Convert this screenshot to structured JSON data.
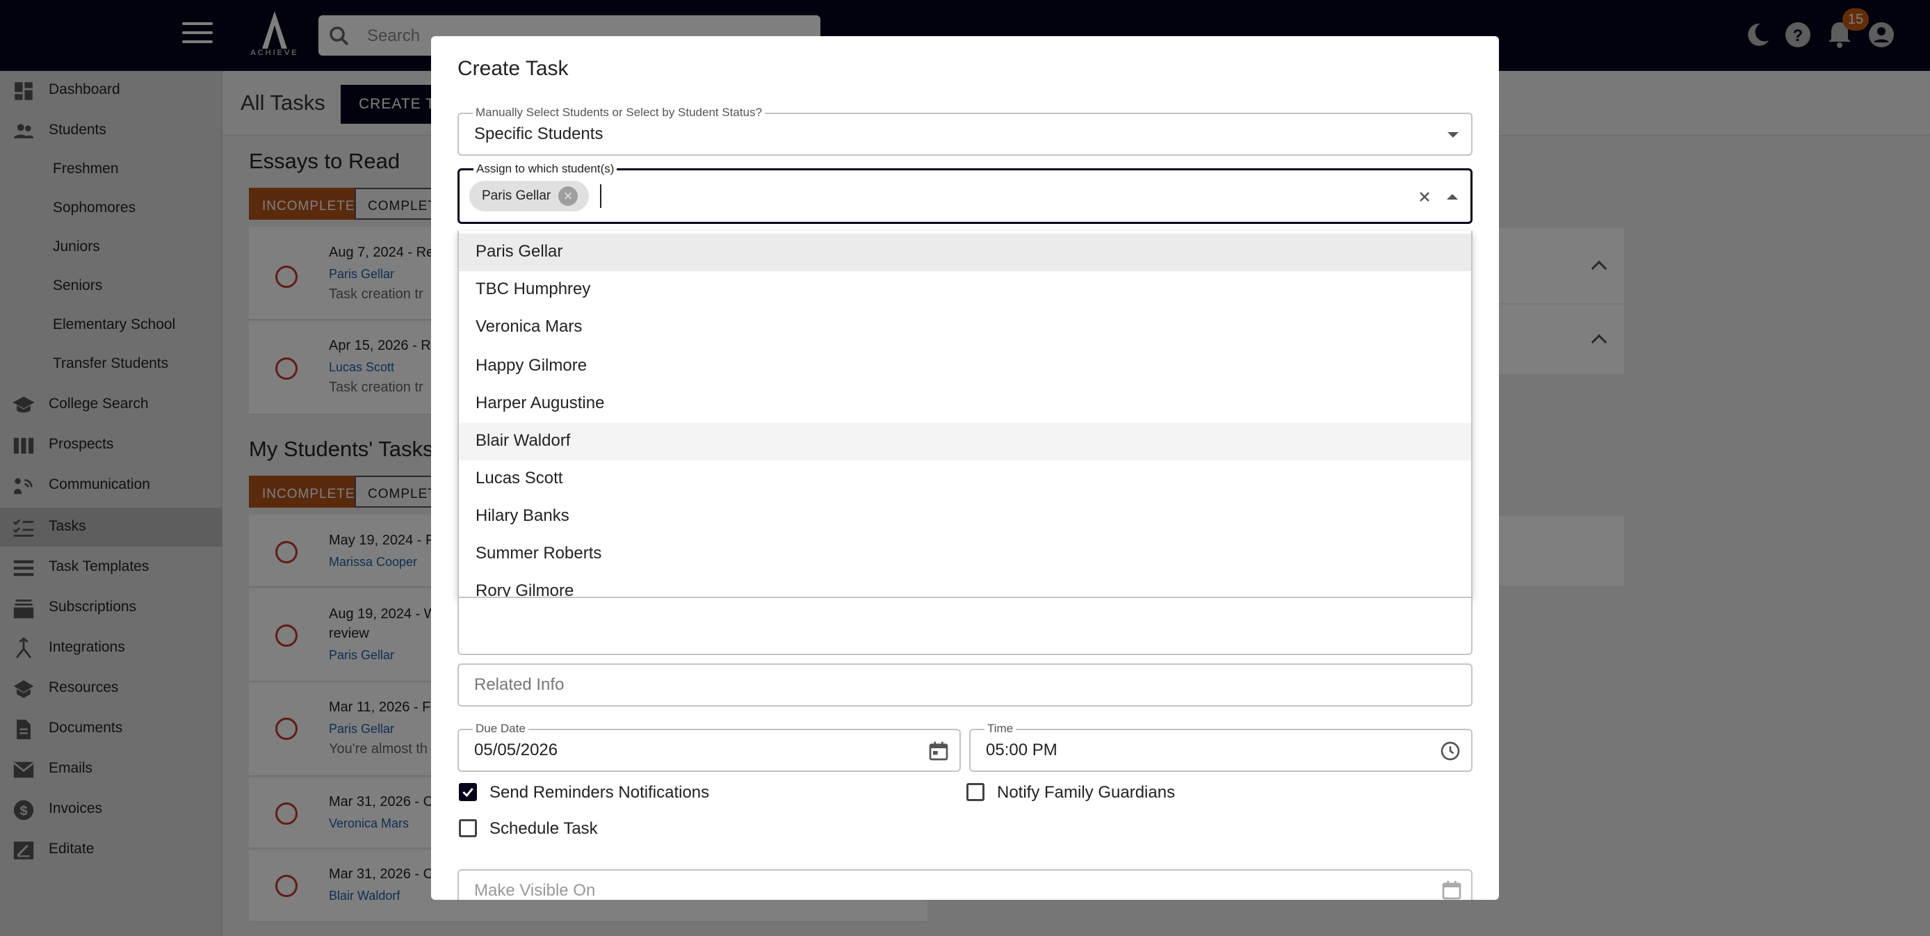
{
  "app": {
    "logo_text": "ACHIEVE",
    "search_placeholder": "Search",
    "notification_count": "15"
  },
  "sidebar": {
    "items": [
      {
        "label": "Dashboard",
        "icon": "dashboard-icon"
      },
      {
        "label": "Students",
        "icon": "students-icon"
      },
      {
        "label": "Freshmen"
      },
      {
        "label": "Sophomores"
      },
      {
        "label": "Juniors"
      },
      {
        "label": "Seniors"
      },
      {
        "label": "Elementary School"
      },
      {
        "label": "Transfer Students"
      },
      {
        "label": "College Search",
        "icon": "graduation-cap-icon"
      },
      {
        "label": "Prospects",
        "icon": "columns-icon"
      },
      {
        "label": "Communication",
        "icon": "communication-icon"
      },
      {
        "label": "Tasks",
        "icon": "checklist-icon"
      },
      {
        "label": "Task Templates",
        "icon": "list-icon"
      },
      {
        "label": "Subscriptions",
        "icon": "subscriptions-icon"
      },
      {
        "label": "Integrations",
        "icon": "merge-icon"
      },
      {
        "label": "Resources",
        "icon": "school-icon"
      },
      {
        "label": "Documents",
        "icon": "document-icon"
      },
      {
        "label": "Emails",
        "icon": "mail-icon"
      },
      {
        "label": "Invoices",
        "icon": "dollar-icon"
      },
      {
        "label": "Editate",
        "icon": "edit-note-icon"
      }
    ]
  },
  "main": {
    "title": "All Tasks",
    "create_task_label": "CREATE TASK",
    "essays_section": {
      "title": "Essays to Read",
      "tab_incomplete": "INCOMPLETE",
      "tab_complete": "COMPLETE",
      "tasks": [
        {
          "title": "Aug 7, 2024 - Re",
          "student": "Paris Gellar",
          "desc": "Task creation tr"
        },
        {
          "title": "Apr 15, 2026 - R",
          "student": "Lucas Scott",
          "desc": "Task creation tr"
        }
      ]
    },
    "students_section": {
      "title": "My Students' Tasks",
      "tab_incomplete": "INCOMPLETE",
      "tab_complete": "COMPLETE",
      "tasks": [
        {
          "title": "May 19, 2024 - F",
          "student": "Marissa Cooper",
          "desc": ""
        },
        {
          "title": "Aug 19, 2024 - W",
          "title2": "review",
          "student": "Paris Gellar",
          "desc": ""
        },
        {
          "title": "Mar 11, 2026 - F",
          "student": "Paris Gellar",
          "desc": "You're almost th"
        },
        {
          "title": "Mar 31, 2026 - C",
          "student": "Veronica Mars",
          "desc": ""
        },
        {
          "title": "Mar 31, 2026 - C",
          "student": "Blair Waldorf",
          "desc": ""
        }
      ]
    }
  },
  "dialog": {
    "title": "Create Task",
    "select_mode": {
      "label": "Manually Select Students or Select by Student Status?",
      "value": "Specific Students"
    },
    "assign": {
      "label": "Assign to which student(s)",
      "chip": "Paris Gellar"
    },
    "options": [
      "Paris Gellar",
      "TBC Humphrey",
      "Veronica Mars",
      "Happy Gilmore",
      "Harper Augustine",
      "Blair Waldorf",
      "Lucas Scott",
      "Hilary Banks",
      "Summer Roberts",
      "Rory Gilmore"
    ],
    "related_info_placeholder": "Related Info",
    "due_date": {
      "label": "Due Date",
      "value": "05/05/2026"
    },
    "time": {
      "label": "Time",
      "value": "05:00 PM"
    },
    "send_reminders": {
      "label": "Send Reminders Notifications",
      "checked": true
    },
    "notify_guardians": {
      "label": "Notify Family Guardians",
      "checked": false
    },
    "schedule_task": {
      "label": "Schedule Task",
      "checked": false
    },
    "make_visible_placeholder": "Make Visible On"
  },
  "colors": {
    "topbar": "#05041c",
    "accent_orange": "#b4541a",
    "link_blue": "#1e5fa8",
    "task_circle_red": "#c0392b"
  }
}
